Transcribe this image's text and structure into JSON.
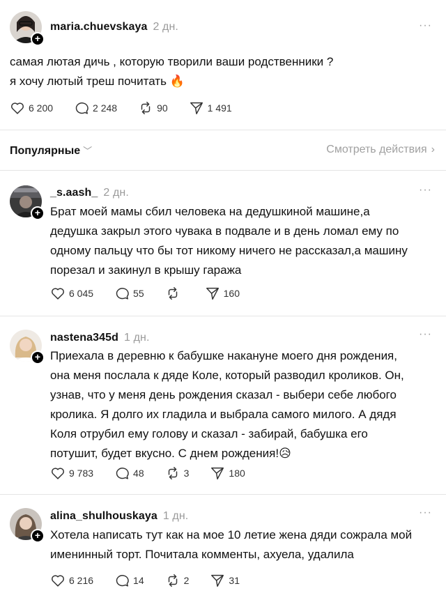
{
  "main_post": {
    "username": "maria.chuevskaya",
    "time": "2 дн.",
    "more": "···",
    "text_line1": "самая лютая дичь , которую творили ваши родственники ?",
    "text_line2": "я хочу лютый треш почитать 🔥",
    "likes": "6 200",
    "comments": "2 248",
    "reposts": "90",
    "shares": "1 491"
  },
  "sort": {
    "label": "Популярные",
    "chevron": "﹀",
    "view_activity": "Смотреть действия",
    "view_chevron": "›"
  },
  "replies": [
    {
      "username": "_s.aash_",
      "time": "2 дн.",
      "more": "···",
      "lines": [
        "Брат моей мамы сбил человека на дедушкиной машине,а",
        "дедушка закрыл этого чувака в подвале и в день ломал ему по",
        "одному пальцу что бы тот никому ничего не рассказал,а машину",
        "порезал и закинул в крышу гаража"
      ],
      "likes": "6 045",
      "comments": "55",
      "reposts": "",
      "shares": "160"
    },
    {
      "username": "nastena345d",
      "time": "1 дн.",
      "more": "···",
      "lines": [
        "Приехала в деревню к бабушке накануне моего дня рождения,",
        "она меня послала к дяде Коле, который разводил кроликов. Он,",
        "узнав, что у меня день рождения сказал - выбери себе любого",
        "кролика. Я долго их гладила и выбрала самого милого. А дядя",
        "Коля отрубил ему голову и сказал - забирай, бабушка его",
        "потушит, будет вкусно. С днем рождения!😥"
      ],
      "likes": "9 783",
      "comments": "48",
      "reposts": "3",
      "shares": "180"
    },
    {
      "username": "alina_shulhouskaya",
      "time": "1 дн.",
      "more": "···",
      "lines": [
        "Хотела написать тут как на мое 10 летие жена дяди сожрала мой",
        "именинный торт. Почитала комменты, ахуела, удалила"
      ],
      "likes": "6 216",
      "comments": "14",
      "reposts": "2",
      "shares": "31"
    }
  ],
  "icons": {
    "like": "heart-icon",
    "comment": "comment-bubble-icon",
    "repost": "repost-icon",
    "share": "send-icon",
    "follow": "plus-icon"
  }
}
